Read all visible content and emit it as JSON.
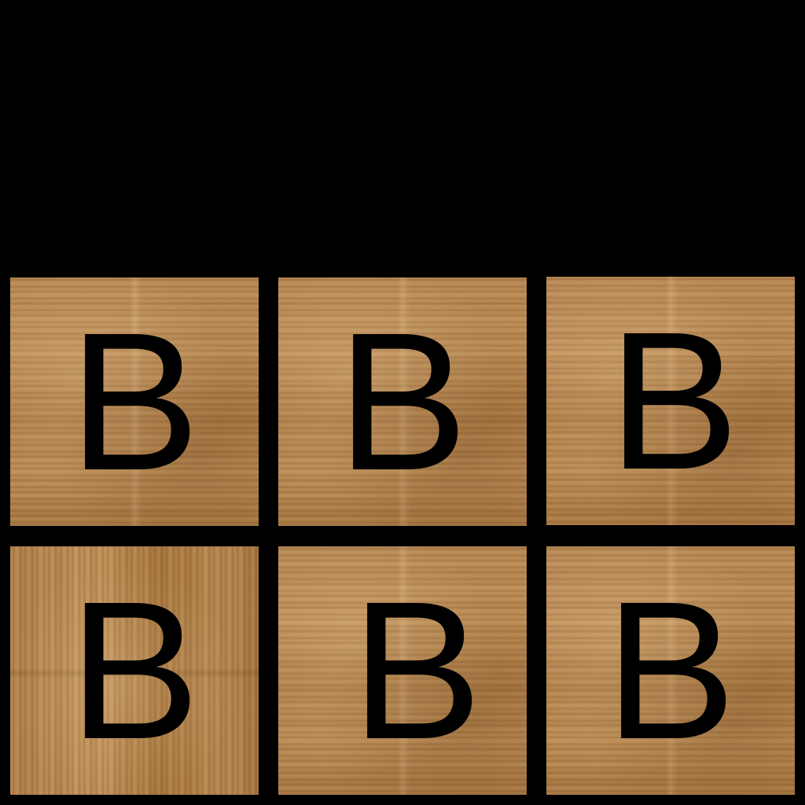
{
  "board": {
    "background_color": "#000000",
    "tile_color": "#b7874f",
    "letter_color": "#000000",
    "tiles": [
      {
        "letter": "B",
        "grain": "horizontal"
      },
      {
        "letter": "B",
        "grain": "horizontal"
      },
      {
        "letter": "B",
        "grain": "horizontal"
      },
      {
        "letter": "B",
        "grain": "vertical"
      },
      {
        "letter": "B",
        "grain": "horizontal"
      },
      {
        "letter": "B",
        "grain": "horizontal"
      }
    ]
  }
}
